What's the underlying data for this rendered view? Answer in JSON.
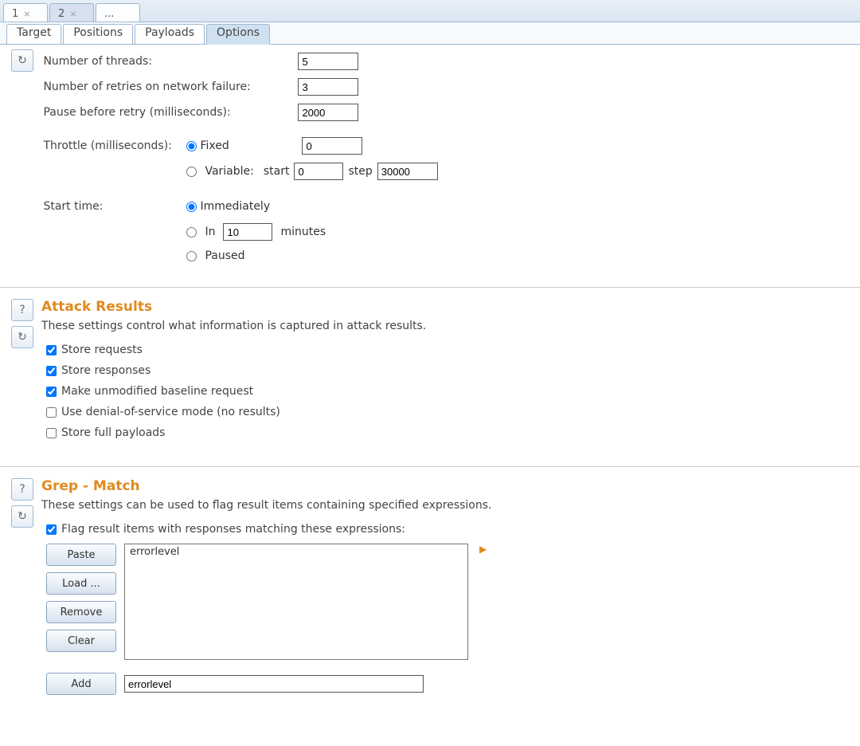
{
  "topTabs": {
    "t1": "1",
    "t2": "2",
    "t3": "..."
  },
  "subTabs": {
    "target": "Target",
    "positions": "Positions",
    "payloads": "Payloads",
    "options": "Options"
  },
  "req": {
    "threads_label": "Number of threads:",
    "threads_val": "5",
    "retries_label": "Number of retries on network failure:",
    "retries_val": "3",
    "pause_label": "Pause before retry (milliseconds):",
    "pause_val": "2000",
    "throttle_label": "Throttle (milliseconds):",
    "fixed_label": "Fixed",
    "fixed_val": "0",
    "variable_label": "Variable:",
    "start_label": "start",
    "start_val": "0",
    "step_label": "step",
    "step_val": "30000",
    "starttime_label": "Start time:",
    "immediately": "Immediately",
    "in_label": "In",
    "in_val": "10",
    "minutes": "minutes",
    "paused": "Paused"
  },
  "attack": {
    "title": "Attack Results",
    "desc": "These settings control what information is captured in attack results.",
    "c1": "Store requests",
    "c2": "Store responses",
    "c3": "Make unmodified baseline request",
    "c4": "Use denial-of-service mode (no results)",
    "c5": "Store full payloads"
  },
  "grep": {
    "title": "Grep - Match",
    "desc": "These settings can be used to flag result items containing specified expressions.",
    "flag": "Flag result items with responses matching these expressions:",
    "paste": "Paste",
    "load": "Load ...",
    "remove": "Remove",
    "clear": "Clear",
    "add": "Add",
    "list_item": "errorlevel",
    "add_val": "errorlevel"
  }
}
